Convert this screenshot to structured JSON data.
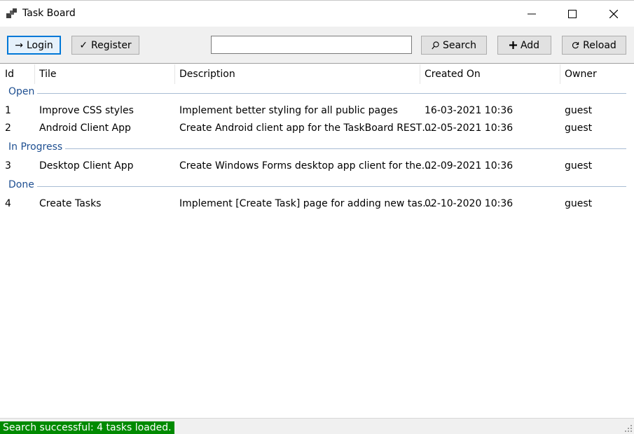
{
  "window": {
    "title": "Task Board"
  },
  "toolbar": {
    "login_label": "Login",
    "register_label": "Register",
    "search_value": "",
    "search_label": "Search",
    "add_label": "Add",
    "reload_label": "Reload"
  },
  "columns": [
    "Id",
    "Tile",
    "Description",
    "Created On",
    "Owner"
  ],
  "groups": [
    {
      "name": "Open",
      "rows": [
        {
          "id": "1",
          "title": "Improve CSS styles",
          "description": "Implement better styling for all public pages",
          "created": "16-03-2021 10:36",
          "owner": "guest"
        },
        {
          "id": "2",
          "title": "Android Client App",
          "description": "Create Android client app for the TaskBoard REST…",
          "created": "02-05-2021 10:36",
          "owner": "guest"
        }
      ]
    },
    {
      "name": "In Progress",
      "rows": [
        {
          "id": "3",
          "title": "Desktop Client App",
          "description": "Create Windows Forms desktop app client for the…",
          "created": "02-09-2021 10:36",
          "owner": "guest"
        }
      ]
    },
    {
      "name": "Done",
      "rows": [
        {
          "id": "4",
          "title": "Create Tasks",
          "description": "Implement [Create Task] page for adding new tas…",
          "created": "02-10-2020 10:36",
          "owner": "guest"
        }
      ]
    }
  ],
  "status": {
    "text": "Search successful: 4 tasks loaded.",
    "color": "#008a00"
  }
}
